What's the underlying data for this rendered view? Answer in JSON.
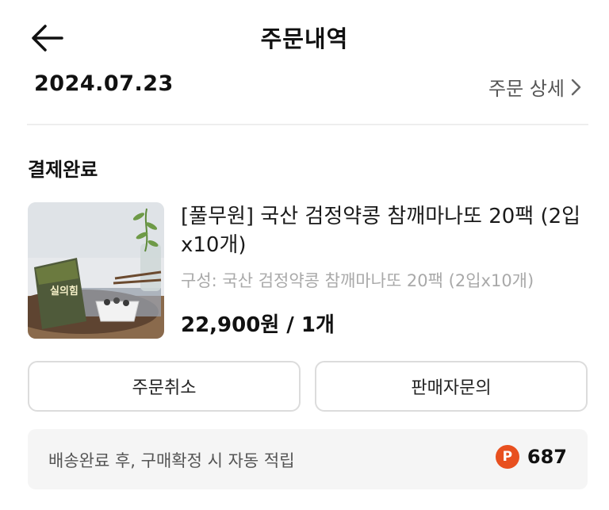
{
  "header": {
    "title": "주문내역",
    "back_icon": "arrow-left-icon"
  },
  "order": {
    "date": "2024.07.23",
    "detail_link": "주문 상세",
    "status": "결제완료"
  },
  "product": {
    "name": "[풀무원] 국산 검정약콩 참깨마나또 20팩 (2입x10개)",
    "option": "구성: 국산 검정약콩 참깨마나또 20팩 (2입x10개)",
    "price": "22,900원 / 1개",
    "package_text": "실의힘"
  },
  "actions": {
    "cancel": "주문취소",
    "inquiry": "판매자문의"
  },
  "points": {
    "description": "배송완료 후, 구매확정 시 자동 적립",
    "icon_letter": "P",
    "value": "687",
    "color": "#e8501f"
  }
}
